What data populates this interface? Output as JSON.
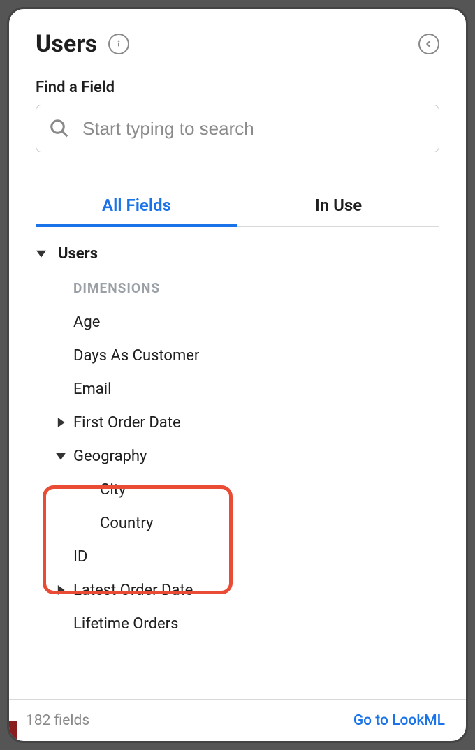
{
  "header": {
    "title": "Users",
    "find_label": "Find a Field",
    "search_placeholder": "Start typing to search"
  },
  "tabs": {
    "all_fields": "All Fields",
    "in_use": "In Use"
  },
  "tree": {
    "group": "Users",
    "section_heading": "DIMENSIONS",
    "items": {
      "age": "Age",
      "days_as_customer": "Days As Customer",
      "email": "Email",
      "first_order_date": "First Order Date",
      "geography": "Geography",
      "city": "City",
      "country": "Country",
      "id": "ID",
      "latest_order_date": "Latest Order Date",
      "lifetime_orders": "Lifetime Orders"
    }
  },
  "footer": {
    "field_count": "182 fields",
    "go_link": "Go to LookML"
  }
}
